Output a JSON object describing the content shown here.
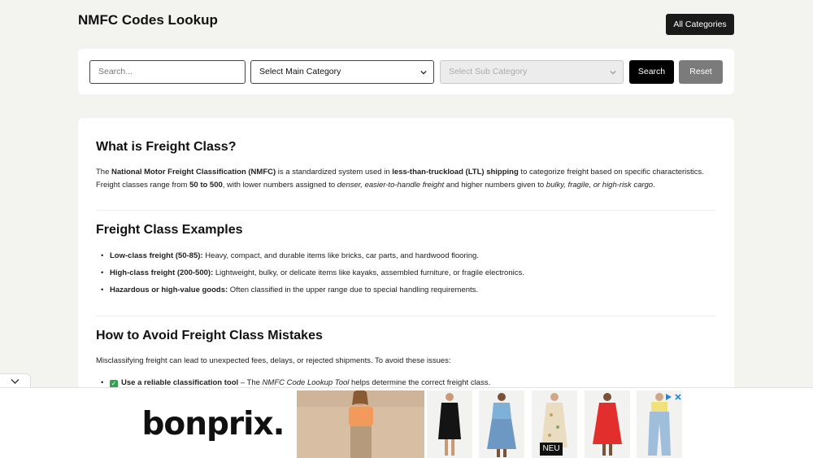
{
  "header": {
    "title": "NMFC Codes Lookup",
    "all_categories_label": "All Categories"
  },
  "search": {
    "placeholder": "Search...",
    "main_category": "Select Main Category",
    "sub_category": "Select Sub Category",
    "search_label": "Search",
    "reset_label": "Reset"
  },
  "content": {
    "section1": {
      "heading": "What is Freight Class?",
      "p1_a": "The ",
      "p1_b": "National Motor Freight Classification (NMFC)",
      "p1_c": " is a standardized system used in ",
      "p1_d": "less-than-truckload (LTL) shipping",
      "p1_e": " to categorize freight based on specific characteristics.",
      "p2_a": "Freight classes range from ",
      "p2_b": "50 to 500",
      "p2_c": ", with lower numbers assigned to ",
      "p2_d": "denser, easier-to-handle freight",
      "p2_e": " and higher numbers given to ",
      "p2_f": "bulky, fragile, or high-risk cargo",
      "p2_g": "."
    },
    "section2": {
      "heading": "Freight Class Examples",
      "items": [
        {
          "bold": "Low-class freight (50-85):",
          "text": " Heavy, compact, and durable items like bricks, car parts, and hardwood flooring."
        },
        {
          "bold": "High-class freight (200-500):",
          "text": " Lightweight, bulky, or delicate items like kayaks, assembled furniture, or fragile electronics."
        },
        {
          "bold": "Hazardous or high-value goods:",
          "text": " Often classified in the upper range due to special handling requirements."
        }
      ]
    },
    "section3": {
      "heading": "How to Avoid Freight Class Mistakes",
      "intro": "Misclassifying freight can lead to unexpected fees, delays, or rejected shipments. To avoid these issues:",
      "item1_bold": "Use a reliable classification tool",
      "item1_a": " – The ",
      "item1_italic": "NMFC Code Lookup Tool",
      "item1_b": " helps determine the correct freight class."
    }
  },
  "ad": {
    "brand": "bonprix.",
    "badge": "NEU",
    "accent": "#e53935"
  }
}
